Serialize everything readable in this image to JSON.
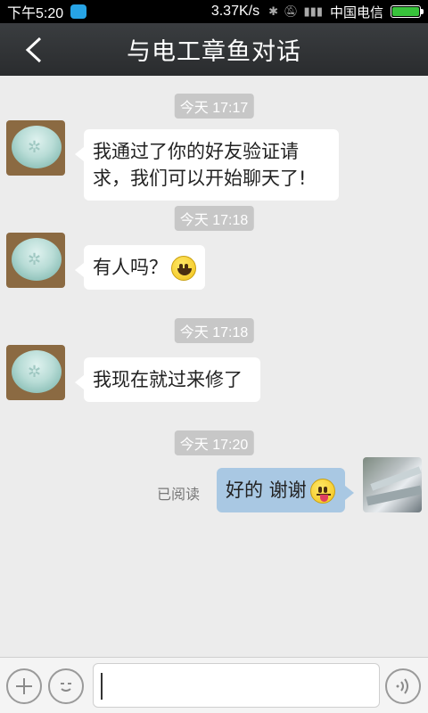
{
  "status_bar": {
    "time": "下午5:20",
    "speed": "3.37K/s",
    "carrier": "中国电信",
    "battery_level": 1.0,
    "battery_color": "#38c33b"
  },
  "header": {
    "title": "与电工章鱼对话",
    "back_icon": "chevron-left-icon"
  },
  "messages": [
    {
      "timestamp": "今天 17:17",
      "side": "left",
      "text": "我通过了你的好友验证请求，我们可以开始聊天了!",
      "line1": "我通过了你的好友验证请",
      "line2": "求，我们可以开始聊天了!"
    },
    {
      "timestamp": "今天 17:18",
      "side": "left",
      "text": "有人吗？",
      "emoji": "grinning-face-icon"
    },
    {
      "timestamp": "今天 17:18",
      "side": "left",
      "text": "我现在就过来修了"
    },
    {
      "timestamp": "今天 17:20",
      "side": "right",
      "text": "好的 谢谢",
      "emoji": "tongue-face-icon",
      "read_status": "已阅读"
    }
  ],
  "input_bar": {
    "plus_icon": "plus-icon",
    "emoji_icon": "emoji-face-icon",
    "voice_icon": "voice-icon",
    "text_value": ""
  },
  "colors": {
    "header_bg": "#2f3133",
    "chat_bg": "#ececec",
    "outgoing_bubble": "#a9c8e3",
    "incoming_bubble": "#ffffff"
  }
}
